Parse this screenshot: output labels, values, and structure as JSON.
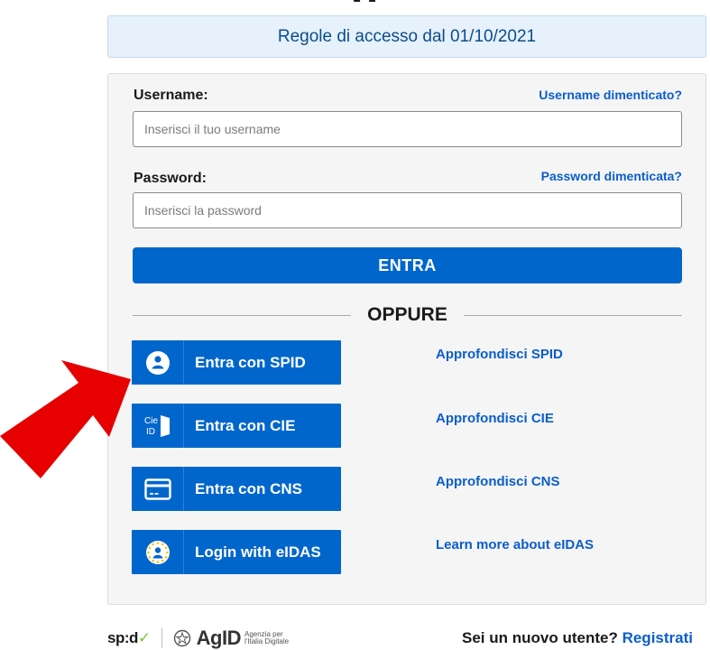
{
  "header": {
    "title_fragment": "g"
  },
  "rules_banner": {
    "text": "Regole di accesso dal 01/10/2021"
  },
  "login_form": {
    "username": {
      "label": "Username:",
      "forgot_link": "Username dimenticato?",
      "placeholder": "Inserisci il tuo username",
      "value": ""
    },
    "password": {
      "label": "Password:",
      "forgot_link": "Password dimenticata?",
      "placeholder": "Inserisci la password",
      "value": ""
    },
    "submit_label": "ENTRA",
    "divider_text": "OPPURE"
  },
  "auth_methods": [
    {
      "label": "Entra con SPID",
      "icon": "spid-user-icon",
      "learn_more": "Approfondisci SPID"
    },
    {
      "label": "Entra con CIE",
      "icon": "cie-id-icon",
      "icon_text_top": "Cie",
      "icon_text_bottom": "ID",
      "learn_more": "Approfondisci CIE"
    },
    {
      "label": "Entra con CNS",
      "icon": "card-icon",
      "learn_more": "Approfondisci CNS"
    },
    {
      "label": "Login with eIDAS",
      "icon": "eidas-icon",
      "learn_more": "Learn more about eIDAS"
    }
  ],
  "annotation": {
    "arrow_color": "#e60000",
    "icon": "red-arrow-icon"
  },
  "footer": {
    "spid_logo_prefix": "sp",
    "spid_logo_mid": ":",
    "spid_logo_suffix": "d",
    "spid_check": "✓",
    "agid_logo": "AgID",
    "agid_sub_1": "Agenzia per",
    "agid_sub_2": "l'Italia Digitale",
    "new_user_text": "Sei un nuovo utente?",
    "register_link": "Registrati"
  },
  "colors": {
    "primary_blue": "#0066cc",
    "link_blue": "#0b5ec9",
    "banner_bg": "#e6f1fb",
    "card_bg": "#f5f5f5"
  }
}
